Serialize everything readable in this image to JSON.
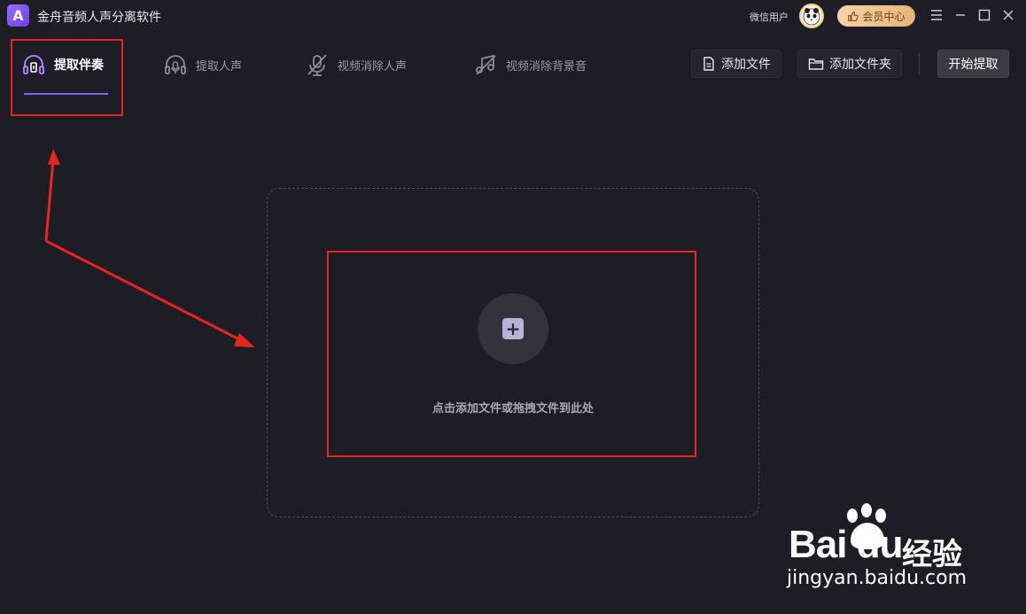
{
  "app": {
    "title": "金舟音频人声分离软件",
    "logo_letter": "A"
  },
  "user": {
    "name": "微信用户",
    "vip_label": "会员中心"
  },
  "tabs": [
    {
      "label": "提取伴奏",
      "active": true,
      "icon": "headphone-accompaniment-icon"
    },
    {
      "label": "提取人声",
      "active": false,
      "icon": "headphone-mic-icon"
    },
    {
      "label": "视频消除人声",
      "active": false,
      "icon": "mic-off-icon"
    },
    {
      "label": "视频消除背景音",
      "active": false,
      "icon": "music-off-icon"
    }
  ],
  "actions": {
    "add_file": "添加文件",
    "add_folder": "添加文件夹",
    "start": "开始提取"
  },
  "dropzone": {
    "hint": "点击添加文件或拖拽文件到此处"
  },
  "watermark": {
    "logo": "Bai du",
    "brand": "经验",
    "url": "jingyan.baidu.com"
  },
  "colors": {
    "background": "#1d1d25",
    "accent": "#8a5cf6",
    "annotation": "#e8241c",
    "vip_gold": "#e8b27a"
  }
}
